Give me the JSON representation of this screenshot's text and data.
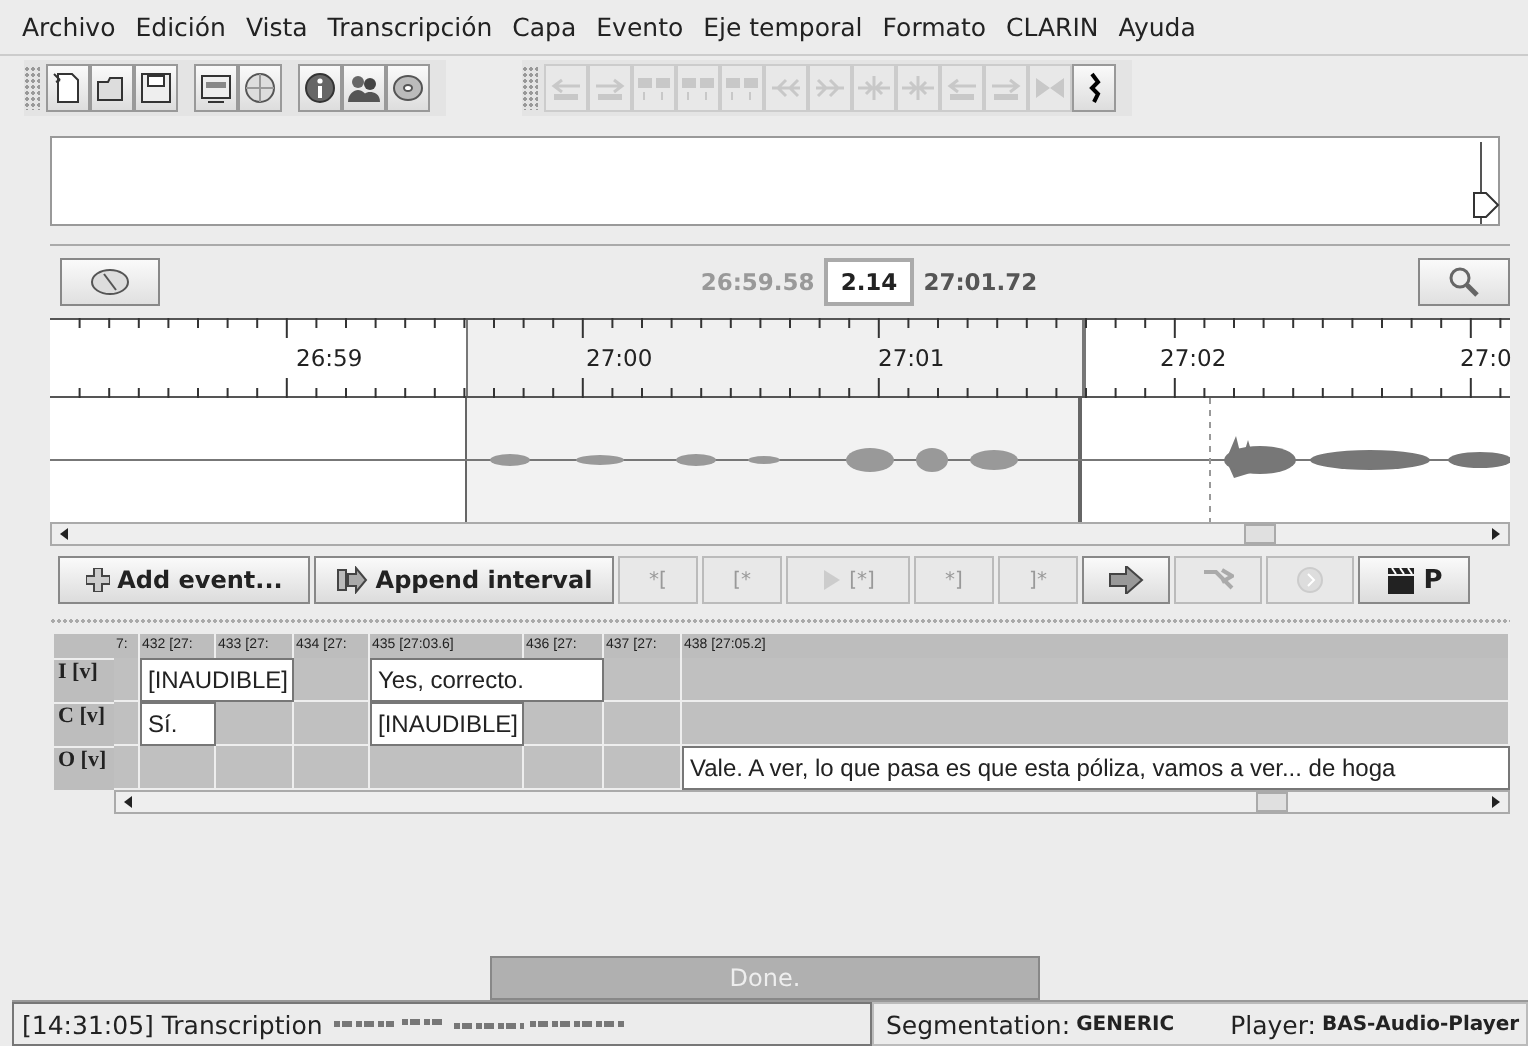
{
  "menu": [
    {
      "label": "Archivo"
    },
    {
      "label": "Edición"
    },
    {
      "label": "Vista"
    },
    {
      "label": "Transcripción"
    },
    {
      "label": "Capa"
    },
    {
      "label": "Evento"
    },
    {
      "label": "Eje temporal"
    },
    {
      "label": "Formato"
    },
    {
      "label": "CLARIN"
    },
    {
      "label": "Ayuda"
    }
  ],
  "volume_slider": {
    "level": 0.1
  },
  "toolbars": [
    {
      "groups": [
        [
          {
            "kind": "document",
            "disabled": false
          },
          {
            "kind": "folder",
            "disabled": false
          },
          {
            "kind": "floppy",
            "disabled": false
          }
        ],
        [
          {
            "kind": "window",
            "disabled": false
          },
          {
            "kind": "globe",
            "disabled": false
          }
        ],
        [
          {
            "kind": "info",
            "disabled": false
          },
          {
            "kind": "people",
            "disabled": false
          },
          {
            "kind": "disc",
            "disabled": false
          }
        ]
      ]
    },
    {
      "groups": [
        [
          {
            "kind": "arrow-left",
            "disabled": true
          },
          {
            "kind": "arrow-right",
            "disabled": true
          },
          {
            "kind": "blocks",
            "disabled": true
          },
          {
            "kind": "blocks",
            "disabled": true
          },
          {
            "kind": "blocks",
            "disabled": true
          },
          {
            "kind": "double-left",
            "disabled": true
          },
          {
            "kind": "double-right",
            "disabled": true
          },
          {
            "kind": "merge",
            "disabled": true
          },
          {
            "kind": "merge",
            "disabled": true
          },
          {
            "kind": "arrow-left",
            "disabled": true
          },
          {
            "kind": "arrow-right",
            "disabled": true
          },
          {
            "kind": "bowtie",
            "disabled": true
          },
          {
            "kind": "squiggle",
            "disabled": false
          }
        ]
      ]
    }
  ],
  "timebar": {
    "start": "26:59.58",
    "duration": "2.14",
    "end": "27:01.72"
  },
  "ruler": {
    "labels": [
      "26:59",
      "27:00",
      "27:01",
      "27:02",
      "27:0"
    ]
  },
  "buttons": [
    {
      "label": "Add event...",
      "kind": "plus",
      "disabled": false
    },
    {
      "label": "Append interval",
      "kind": "append",
      "disabled": false
    },
    {
      "label": "*[",
      "kind": "text",
      "disabled": true
    },
    {
      "label": "[*",
      "kind": "text",
      "disabled": true
    },
    {
      "label": "[*]",
      "kind": "play",
      "disabled": true
    },
    {
      "label": "*]",
      "kind": "text",
      "disabled": true
    },
    {
      "label": "]*",
      "kind": "text",
      "disabled": true
    },
    {
      "kind": "arrow",
      "disabled": false
    },
    {
      "kind": "shuffle",
      "disabled": true
    },
    {
      "kind": "circle",
      "disabled": true
    },
    {
      "label": "P",
      "kind": "clapper",
      "disabled": false
    }
  ],
  "table": {
    "columns": [
      "7:",
      "432 [27:",
      "433 [27:",
      "434 [27:",
      "435 [27:03.6]",
      "436 [27:",
      "437 [27:",
      "438 [27:05.2]"
    ],
    "rows": [
      {
        "tier": "I [v]",
        "cells": [
          {
            "kind": "empty"
          },
          {
            "kind": "event",
            "text": "[INAUDIBLE]"
          },
          {
            "kind": "continuation"
          },
          {
            "kind": "empty"
          },
          {
            "kind": "event",
            "text": "Yes, correcto."
          },
          {
            "kind": "continuation"
          },
          {
            "kind": "empty"
          },
          {
            "kind": "empty"
          }
        ]
      },
      {
        "tier": "C [v]",
        "cells": [
          {
            "kind": "empty"
          },
          {
            "kind": "event",
            "text": "Sí."
          },
          {
            "kind": "empty"
          },
          {
            "kind": "empty"
          },
          {
            "kind": "event",
            "text": "[INAUDIBLE]"
          },
          {
            "kind": "empty"
          },
          {
            "kind": "empty"
          },
          {
            "kind": "empty"
          }
        ]
      },
      {
        "tier": "O [v]",
        "cells": [
          {
            "kind": "empty"
          },
          {
            "kind": "empty"
          },
          {
            "kind": "empty"
          },
          {
            "kind": "empty"
          },
          {
            "kind": "empty"
          },
          {
            "kind": "empty"
          },
          {
            "kind": "empty"
          },
          {
            "kind": "event",
            "text": "Vale. A ver, lo que pasa es que esta póliza, vamos a ver... de hoga"
          }
        ]
      }
    ]
  },
  "progress": {
    "label": "Done."
  },
  "status_bar": {
    "message": "[14:31:05] Transcription",
    "segmentation_label": "Segmentation:",
    "segmentation": "GENERIC",
    "player_label": "Player:",
    "player": "BAS-Audio-Player"
  }
}
